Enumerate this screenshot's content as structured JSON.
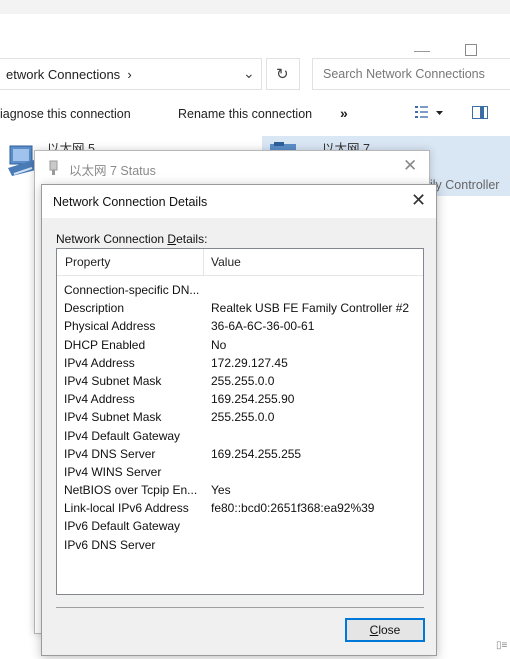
{
  "explorer": {
    "address": "etwork Connections",
    "address_sep": "›",
    "address_dropdown": "⌄",
    "refresh_glyph": "↻",
    "search_placeholder": "Search Network Connections",
    "commands": {
      "diagnose": "iagnose this connection",
      "rename": "Rename this connection",
      "more": "»"
    },
    "adapters": [
      {
        "name": "以太网 5"
      },
      {
        "name": "以太网 7",
        "controller": "ily Controller"
      }
    ],
    "icons": [
      "network-adapter-icon",
      "refresh-icon",
      "chevron-down-icon",
      "view-options-icon",
      "preview-pane-icon"
    ]
  },
  "status_dialog": {
    "title": "以太网 7 Status",
    "close_glyph": "✕"
  },
  "details_dialog": {
    "title": "Network Connection Details",
    "close_glyph": "✕",
    "label_before": "Network Connection ",
    "label_underlined": "D",
    "label_after": "etails:",
    "columns": {
      "property": "Property",
      "value": "Value"
    },
    "rows": [
      {
        "property": "Connection-specific DN...",
        "value": ""
      },
      {
        "property": "Description",
        "value": "Realtek USB FE Family Controller #2"
      },
      {
        "property": "Physical Address",
        "value": "36-6A-6C-36-00-61"
      },
      {
        "property": "DHCP Enabled",
        "value": "No"
      },
      {
        "property": "IPv4 Address",
        "value": "172.29.127.45"
      },
      {
        "property": "IPv4 Subnet Mask",
        "value": "255.255.0.0"
      },
      {
        "property": "IPv4 Address",
        "value": "169.254.255.90"
      },
      {
        "property": "IPv4 Subnet Mask",
        "value": "255.255.0.0"
      },
      {
        "property": "IPv4 Default Gateway",
        "value": ""
      },
      {
        "property": "IPv4 DNS Server",
        "value": "169.254.255.255"
      },
      {
        "property": "IPv4 WINS Server",
        "value": ""
      },
      {
        "property": "NetBIOS over Tcpip En...",
        "value": "Yes"
      },
      {
        "property": "Link-local IPv6 Address",
        "value": "fe80::bcd0:2651f368:ea92%39"
      },
      {
        "property": "IPv6 Default Gateway",
        "value": ""
      },
      {
        "property": "IPv6 DNS Server",
        "value": ""
      }
    ],
    "close_button_underlined": "C",
    "close_button_rest": "lose"
  },
  "colors": {
    "accent": "#0078d7",
    "selection": "#d9e6f4"
  }
}
